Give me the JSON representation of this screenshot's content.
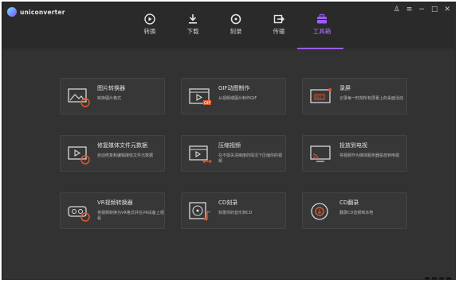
{
  "app": {
    "name": "uniconverter"
  },
  "window_controls": {
    "user": "♙",
    "menu": "≡",
    "minimize": "−",
    "maximize": "□",
    "close": "✕"
  },
  "tabs": [
    {
      "label": "转换",
      "icon": "convert-icon"
    },
    {
      "label": "下载",
      "icon": "download-icon"
    },
    {
      "label": "刻录",
      "icon": "burn-icon"
    },
    {
      "label": "传输",
      "icon": "transfer-icon"
    },
    {
      "label": "工具箱",
      "icon": "toolbox-icon",
      "active": true
    }
  ],
  "colors": {
    "accent": "#9b5cff",
    "orange": "#e0572b",
    "card_bg": "#373737",
    "bg": "#323232"
  },
  "tools": [
    {
      "title": "图片转换器",
      "desc": "转换图片格式",
      "icon": "image-converter-icon"
    },
    {
      "title": "GIF动图制作",
      "desc": "从视频或图片制作GIF",
      "icon": "gif-maker-icon"
    },
    {
      "title": "录屏",
      "desc": "记录每一时刻所有屏幕上的桌面活动",
      "icon": "screen-recorder-icon"
    },
    {
      "title": "修复媒体文件元数据",
      "desc": "自动修复和编辑媒体文件元数据",
      "icon": "metadata-fix-icon"
    },
    {
      "title": "压缩视频",
      "desc": "在不损失清晰度的情况下压缩你的视频",
      "icon": "compress-video-icon"
    },
    {
      "title": "投放到电视",
      "desc": "将视频作为媒体服务器投放到电视",
      "icon": "cast-to-tv-icon"
    },
    {
      "title": "VR视频转换器",
      "desc": "将视频转换为VR格式并在VR设备上观看",
      "icon": "vr-converter-icon"
    },
    {
      "title": "CD刻录",
      "desc": "刻录你的音乐到CD",
      "icon": "cd-burner-icon"
    },
    {
      "title": "CD翻录",
      "desc": "翻录CD音频到本地",
      "icon": "cd-ripper-icon"
    }
  ]
}
